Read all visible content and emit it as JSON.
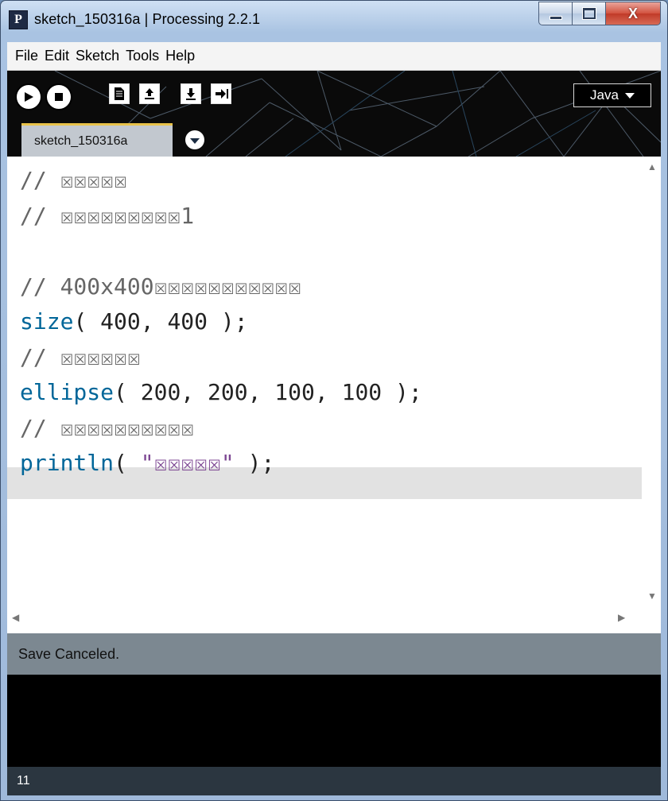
{
  "window": {
    "title": "sketch_150316a | Processing 2.2.1",
    "logo_letter": "P",
    "controls": {
      "close_label": "X"
    }
  },
  "menu": [
    "File",
    "Edit",
    "Sketch",
    "Tools",
    "Help"
  ],
  "toolbar": {
    "buttons": [
      "run-icon",
      "stop-icon",
      "new-icon",
      "open-icon",
      "save-icon",
      "export-icon"
    ],
    "mode_label": "Java"
  },
  "tabs": [
    {
      "label": "sketch_150316a"
    }
  ],
  "code_lines": [
    "// ☒☒☒☒☒",
    "// ☒☒☒☒☒☒☒☒☒1",
    "",
    "// 400x400☒☒☒☒☒☒☒☒☒☒☒",
    "size( 400, 400 );",
    "// ☒☒☒☒☒☒",
    "ellipse( 200, 200, 100, 100 );",
    "// ☒☒☒☒☒☒☒☒☒☒",
    "println( \"☒☒☒☒☒\" );"
  ],
  "code_tokens": {
    "size_fn": "size",
    "size_args": "( 400, 400 );",
    "ellipse_fn": "ellipse",
    "ellipse_args": "( 200, 200, 100, 100 );",
    "println_fn": "println",
    "println_open": "( ",
    "println_str": "\"☒☒☒☒☒\"",
    "println_close": " );"
  },
  "status_message": "Save Canceled.",
  "footer_line_number": "11",
  "colors": {
    "comment": "#666666",
    "function": "#006699",
    "string": "#7d4793",
    "status_bar": "#7c8891",
    "footer": "#2b3640",
    "tab_accent": "#e8c24a"
  }
}
